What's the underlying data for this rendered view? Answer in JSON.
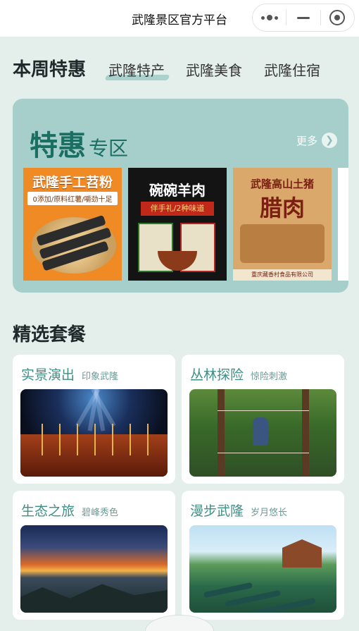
{
  "titlebar": {
    "title": "武隆景区官方平台",
    "menu_icon": "more-dots-icon",
    "minimize_icon": "minus-icon",
    "close_icon": "target-icon"
  },
  "tabs": {
    "heading": "本周特惠",
    "items": [
      {
        "label": "武隆特产",
        "active": true
      },
      {
        "label": "武隆美食",
        "active": false
      },
      {
        "label": "武隆住宿",
        "active": false
      }
    ]
  },
  "offer": {
    "title_big": "特惠",
    "title_small": "专区",
    "more_label": "更多",
    "more_icon": "chevron-right-icon",
    "products": [
      {
        "name": "武隆手工苕粉",
        "tagline": "0添加/原料红薯/嚼劲十足"
      },
      {
        "name": "碗碗羊肉",
        "tagline": "伴手礼/2种味道"
      },
      {
        "name": "武隆高山土猪",
        "name_line2": "腊肉",
        "tagline": "重庆藏香村食品有限公司"
      }
    ]
  },
  "packages": {
    "heading": "精选套餐",
    "items": [
      {
        "name": "实景演出",
        "sub": "印象武隆"
      },
      {
        "name": "丛林探险",
        "sub": "惊险刺激"
      },
      {
        "name": "生态之旅",
        "sub": "碧峰秀色"
      },
      {
        "name": "漫步武隆",
        "sub": "岁月悠长"
      }
    ]
  },
  "colors": {
    "background": "#e4eeeb",
    "offer_card": "#a6cfcc",
    "offer_title": "#1b6f62",
    "package_title": "#3d8f86"
  }
}
